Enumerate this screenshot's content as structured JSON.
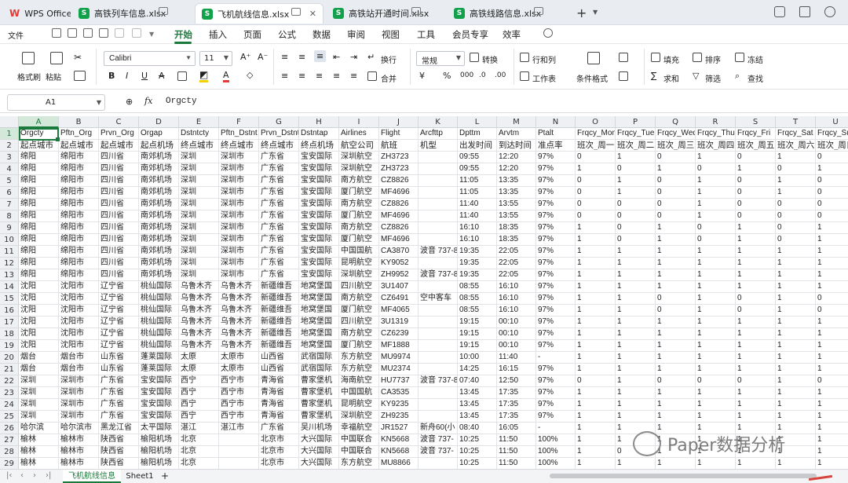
{
  "tabs": {
    "app": "WPS Office",
    "files": [
      "高铁列车信息.xlsx",
      "飞机航线信息.xlsx",
      "高铁站开通时间.xlsx",
      "高铁线路信息.xlsx"
    ]
  },
  "menu": {
    "file": "文件",
    "items": [
      "开始",
      "插入",
      "页面",
      "公式",
      "数据",
      "审阅",
      "视图",
      "工具",
      "会员专享",
      "效率"
    ]
  },
  "toolbar": {
    "format_painter": "格式刷",
    "paste": "粘贴",
    "font": "Calibri",
    "size": "11",
    "wrap": "换行",
    "merge": "合并",
    "number_format": "常规",
    "convert": "转换",
    "rowcol": "行和列",
    "worksheet": "工作表",
    "cond_format": "条件格式",
    "fill": "填充",
    "sort": "排序",
    "freeze": "冻结",
    "sum": "求和",
    "filter": "筛选",
    "find": "查找"
  },
  "formula": {
    "cell_ref": "A1",
    "fx": "fx",
    "content": "Orgcty"
  },
  "sheet": {
    "columns": [
      "A",
      "B",
      "C",
      "D",
      "E",
      "F",
      "G",
      "H",
      "I",
      "J",
      "K",
      "L",
      "M",
      "N",
      "O",
      "P",
      "Q",
      "R",
      "S",
      "T",
      "U"
    ],
    "rows": [
      [
        "Orgcty",
        "Pftn_Org",
        "Prvn_Org",
        "Orgap",
        "Dstntcty",
        "Pftn_Dstnt",
        "Prvn_Dstnt",
        "Dstntap",
        "Airlines",
        "Flight",
        "Arcfttp",
        "Dpttm",
        "Arvtm",
        "Ptalt",
        "Frqcy_Mon",
        "Frqcy_Tue",
        "Frqcy_Wed",
        "Frqcy_Thu",
        "Frqcy_Fri",
        "Frqcy_Sat",
        "Frqcy_Sun"
      ],
      [
        "起点城市",
        "起点城市",
        "起点城市",
        "起点机场",
        "终点城市",
        "终点城市",
        "终点城市",
        "终点机场",
        "航空公司",
        "航班",
        "机型",
        "出发时间",
        "到达时间",
        "准点率",
        "班次_周一",
        "班次_周二",
        "班次_周三",
        "班次_周四",
        "班次_周五",
        "班次_周六",
        "班次_周日"
      ],
      [
        "绵阳",
        "绵阳市",
        "四川省",
        "南郊机场",
        "深圳",
        "深圳市",
        "广东省",
        "宝安国际",
        "深圳航空",
        "ZH3723",
        "",
        "09:55",
        "12:20",
        "97%",
        "0",
        "1",
        "0",
        "1",
        "0",
        "1",
        "0"
      ],
      [
        "绵阳",
        "绵阳市",
        "四川省",
        "南郊机场",
        "深圳",
        "深圳市",
        "广东省",
        "宝安国际",
        "深圳航空",
        "ZH3723",
        "",
        "09:55",
        "12:20",
        "97%",
        "1",
        "0",
        "1",
        "0",
        "1",
        "0",
        "1"
      ],
      [
        "绵阳",
        "绵阳市",
        "四川省",
        "南郊机场",
        "深圳",
        "深圳市",
        "广东省",
        "宝安国际",
        "南方航空",
        "CZ8826",
        "",
        "11:05",
        "13:35",
        "97%",
        "0",
        "1",
        "0",
        "1",
        "0",
        "1",
        "0"
      ],
      [
        "绵阳",
        "绵阳市",
        "四川省",
        "南郊机场",
        "深圳",
        "深圳市",
        "广东省",
        "宝安国际",
        "厦门航空",
        "MF4696",
        "",
        "11:05",
        "13:35",
        "97%",
        "0",
        "1",
        "0",
        "1",
        "0",
        "1",
        "0"
      ],
      [
        "绵阳",
        "绵阳市",
        "四川省",
        "南郊机场",
        "深圳",
        "深圳市",
        "广东省",
        "宝安国际",
        "南方航空",
        "CZ8826",
        "",
        "11:40",
        "13:55",
        "97%",
        "0",
        "0",
        "0",
        "1",
        "0",
        "0",
        "0"
      ],
      [
        "绵阳",
        "绵阳市",
        "四川省",
        "南郊机场",
        "深圳",
        "深圳市",
        "广东省",
        "宝安国际",
        "厦门航空",
        "MF4696",
        "",
        "11:40",
        "13:55",
        "97%",
        "0",
        "0",
        "0",
        "1",
        "0",
        "0",
        "0"
      ],
      [
        "绵阳",
        "绵阳市",
        "四川省",
        "南郊机场",
        "深圳",
        "深圳市",
        "广东省",
        "宝安国际",
        "南方航空",
        "CZ8826",
        "",
        "16:10",
        "18:35",
        "97%",
        "1",
        "0",
        "1",
        "0",
        "1",
        "0",
        "1"
      ],
      [
        "绵阳",
        "绵阳市",
        "四川省",
        "南郊机场",
        "深圳",
        "深圳市",
        "广东省",
        "宝安国际",
        "厦门航空",
        "MF4696",
        "",
        "16:10",
        "18:35",
        "97%",
        "1",
        "0",
        "1",
        "0",
        "1",
        "0",
        "1"
      ],
      [
        "绵阳",
        "绵阳市",
        "四川省",
        "南郊机场",
        "深圳",
        "深圳市",
        "广东省",
        "宝安国际",
        "中国国航",
        "CA3870",
        "波音 737-8",
        "19:35",
        "22:05",
        "97%",
        "1",
        "1",
        "1",
        "1",
        "1",
        "1",
        "1"
      ],
      [
        "绵阳",
        "绵阳市",
        "四川省",
        "南郊机场",
        "深圳",
        "深圳市",
        "广东省",
        "宝安国际",
        "昆明航空",
        "KY9052",
        "",
        "19:35",
        "22:05",
        "97%",
        "1",
        "1",
        "1",
        "1",
        "1",
        "1",
        "1"
      ],
      [
        "绵阳",
        "绵阳市",
        "四川省",
        "南郊机场",
        "深圳",
        "深圳市",
        "广东省",
        "宝安国际",
        "深圳航空",
        "ZH9952",
        "波音 737-8",
        "19:35",
        "22:05",
        "97%",
        "1",
        "1",
        "1",
        "1",
        "1",
        "1",
        "1"
      ],
      [
        "沈阳",
        "沈阳市",
        "辽宁省",
        "桃仙国际",
        "乌鲁木齐",
        "乌鲁木齐",
        "新疆维吾",
        "地窝堡国",
        "四川航空",
        "3U1407",
        "",
        "08:55",
        "16:10",
        "97%",
        "1",
        "1",
        "1",
        "1",
        "1",
        "1",
        "1"
      ],
      [
        "沈阳",
        "沈阳市",
        "辽宁省",
        "桃仙国际",
        "乌鲁木齐",
        "乌鲁木齐",
        "新疆维吾",
        "地窝堡国",
        "南方航空",
        "CZ6491",
        "空中客车",
        "08:55",
        "16:10",
        "97%",
        "1",
        "1",
        "0",
        "1",
        "0",
        "1",
        "0"
      ],
      [
        "沈阳",
        "沈阳市",
        "辽宁省",
        "桃仙国际",
        "乌鲁木齐",
        "乌鲁木齐",
        "新疆维吾",
        "地窝堡国",
        "厦门航空",
        "MF4065",
        "",
        "08:55",
        "16:10",
        "97%",
        "1",
        "1",
        "0",
        "1",
        "0",
        "1",
        "0"
      ],
      [
        "沈阳",
        "沈阳市",
        "辽宁省",
        "桃仙国际",
        "乌鲁木齐",
        "乌鲁木齐",
        "新疆维吾",
        "地窝堡国",
        "四川航空",
        "3U1319",
        "",
        "19:15",
        "00:10",
        "97%",
        "1",
        "1",
        "1",
        "1",
        "1",
        "1",
        "1"
      ],
      [
        "沈阳",
        "沈阳市",
        "辽宁省",
        "桃仙国际",
        "乌鲁木齐",
        "乌鲁木齐",
        "新疆维吾",
        "地窝堡国",
        "南方航空",
        "CZ6239",
        "",
        "19:15",
        "00:10",
        "97%",
        "1",
        "1",
        "1",
        "1",
        "1",
        "1",
        "1"
      ],
      [
        "沈阳",
        "沈阳市",
        "辽宁省",
        "桃仙国际",
        "乌鲁木齐",
        "乌鲁木齐",
        "新疆维吾",
        "地窝堡国",
        "厦门航空",
        "MF1888",
        "",
        "19:15",
        "00:10",
        "97%",
        "1",
        "1",
        "1",
        "1",
        "1",
        "1",
        "1"
      ],
      [
        "烟台",
        "烟台市",
        "山东省",
        "蓬莱国际",
        "太原",
        "太原市",
        "山西省",
        "武宿国际",
        "东方航空",
        "MU9974",
        "",
        "10:00",
        "11:40",
        "-",
        "1",
        "1",
        "1",
        "1",
        "1",
        "1",
        "1"
      ],
      [
        "烟台",
        "烟台市",
        "山东省",
        "蓬莱国际",
        "太原",
        "太原市",
        "山西省",
        "武宿国际",
        "东方航空",
        "MU2374",
        "",
        "14:25",
        "16:15",
        "97%",
        "1",
        "1",
        "1",
        "1",
        "1",
        "1",
        "1"
      ],
      [
        "深圳",
        "深圳市",
        "广东省",
        "宝安国际",
        "西宁",
        "西宁市",
        "青海省",
        "曹家堡机",
        "海南航空",
        "HU7737",
        "波音 737-8",
        "07:40",
        "12:50",
        "97%",
        "0",
        "1",
        "0",
        "0",
        "0",
        "1",
        "0"
      ],
      [
        "深圳",
        "深圳市",
        "广东省",
        "宝安国际",
        "西宁",
        "西宁市",
        "青海省",
        "曹家堡机",
        "中国国航",
        "CA3535",
        "",
        "13:45",
        "17:35",
        "97%",
        "1",
        "1",
        "1",
        "1",
        "1",
        "1",
        "1"
      ],
      [
        "深圳",
        "深圳市",
        "广东省",
        "宝安国际",
        "西宁",
        "西宁市",
        "青海省",
        "曹家堡机",
        "昆明航空",
        "KY9235",
        "",
        "13:45",
        "17:35",
        "97%",
        "1",
        "1",
        "1",
        "1",
        "1",
        "1",
        "1"
      ],
      [
        "深圳",
        "深圳市",
        "广东省",
        "宝安国际",
        "西宁",
        "西宁市",
        "青海省",
        "曹家堡机",
        "深圳航空",
        "ZH9235",
        "",
        "13:45",
        "17:35",
        "97%",
        "1",
        "1",
        "1",
        "1",
        "1",
        "1",
        "1"
      ],
      [
        "哈尔滨",
        "哈尔滨市",
        "黑龙江省",
        "太平国际",
        "湛江",
        "湛江市",
        "广东省",
        "吴川机场",
        "幸福航空",
        "JR1527",
        "新舟60(小",
        "08:40",
        "16:05",
        "-",
        "1",
        "1",
        "1",
        "1",
        "1",
        "1",
        "1"
      ],
      [
        "榆林",
        "榆林市",
        "陕西省",
        "榆阳机场",
        "北京",
        "",
        "北京市",
        "大兴国际",
        "中国联合",
        "KN5668",
        "波音 737-",
        "10:25",
        "11:50",
        "100%",
        "1",
        "1",
        "1",
        "1",
        "1",
        "1",
        "1"
      ],
      [
        "榆林",
        "榆林市",
        "陕西省",
        "榆阳机场",
        "北京",
        "",
        "北京市",
        "大兴国际",
        "中国联合",
        "KN5668",
        "波音 737-",
        "10:25",
        "11:50",
        "100%",
        "1",
        "0",
        "1",
        "1",
        "1",
        "1",
        "1"
      ],
      [
        "榆林",
        "榆林市",
        "陕西省",
        "榆阳机场",
        "北京",
        "",
        "北京市",
        "大兴国际",
        "东方航空",
        "MU8866",
        "",
        "10:25",
        "11:50",
        "100%",
        "1",
        "1",
        "1",
        "1",
        "1",
        "1",
        "1"
      ]
    ]
  },
  "sheetbar": {
    "tabs": [
      "飞机航线信息",
      "Sheet1"
    ],
    "add": "+"
  },
  "watermark": "Paper数据分析",
  "colors": {
    "accent": "#1a7a3c",
    "excel_green": "#11a14a",
    "wps_red": "#e53935"
  }
}
